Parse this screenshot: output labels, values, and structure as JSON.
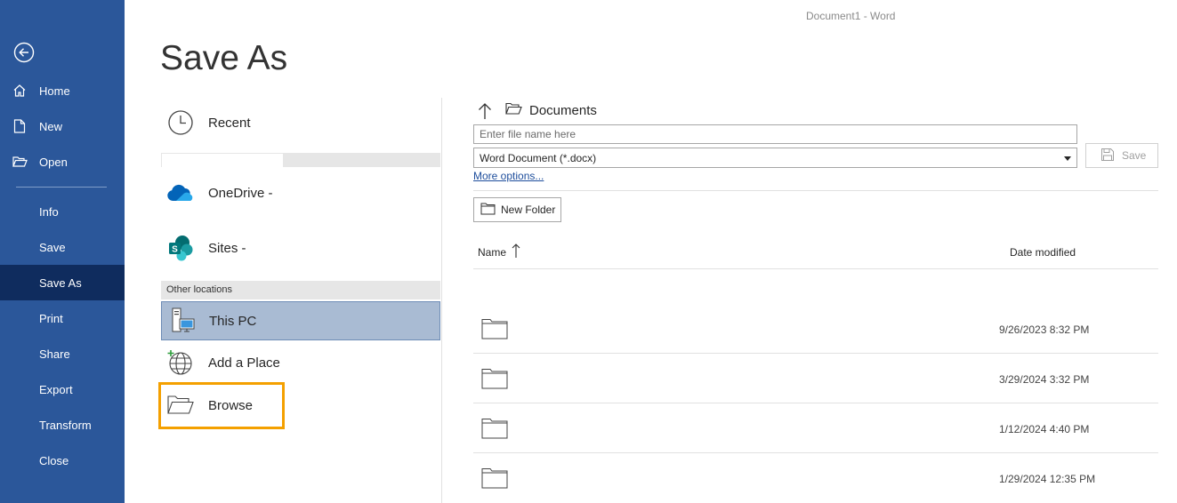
{
  "window": {
    "title": "Document1  -  Word"
  },
  "nav": {
    "back_icon": "back-arrow-circle-icon",
    "items": [
      {
        "label": "Home",
        "icon": "home-icon"
      },
      {
        "label": "New",
        "icon": "new-document-icon"
      },
      {
        "label": "Open",
        "icon": "open-folder-icon"
      },
      {
        "label": "Info"
      },
      {
        "label": "Save"
      },
      {
        "label": "Save As",
        "active": true
      },
      {
        "label": "Print"
      },
      {
        "label": "Share"
      },
      {
        "label": "Export"
      },
      {
        "label": "Transform"
      },
      {
        "label": "Close"
      }
    ],
    "colors": {
      "background": "#2b579a",
      "active": "#0f2c5e"
    }
  },
  "page": {
    "title": "Save As"
  },
  "locations": {
    "recent": {
      "label": "Recent",
      "icon": "clock-icon"
    },
    "onedrive": {
      "label": "OneDrive -",
      "icon": "onedrive-cloud-icon"
    },
    "sites": {
      "label": "Sites -",
      "icon": "sharepoint-icon"
    },
    "other_header": "Other locations",
    "this_pc": {
      "label": "This PC",
      "icon": "computer-icon",
      "selected": true
    },
    "add_place": {
      "label": "Add a Place",
      "icon": "globe-add-icon"
    },
    "browse": {
      "label": "Browse",
      "icon": "folder-open-icon"
    }
  },
  "file_panel": {
    "breadcrumb": "Documents",
    "filename_placeholder": "Enter file name here",
    "filetype": "Word Document (*.docx)",
    "save_label": "Save",
    "more_options": "More options...",
    "new_folder_label": "New Folder",
    "columns": {
      "name": "Name",
      "date": "Date modified"
    },
    "rows": [
      {
        "date": "9/26/2023 8:32 PM"
      },
      {
        "date": "3/29/2024 3:32 PM"
      },
      {
        "date": "1/12/2024 4:40 PM"
      },
      {
        "date": "1/29/2024 12:35 PM"
      }
    ]
  }
}
